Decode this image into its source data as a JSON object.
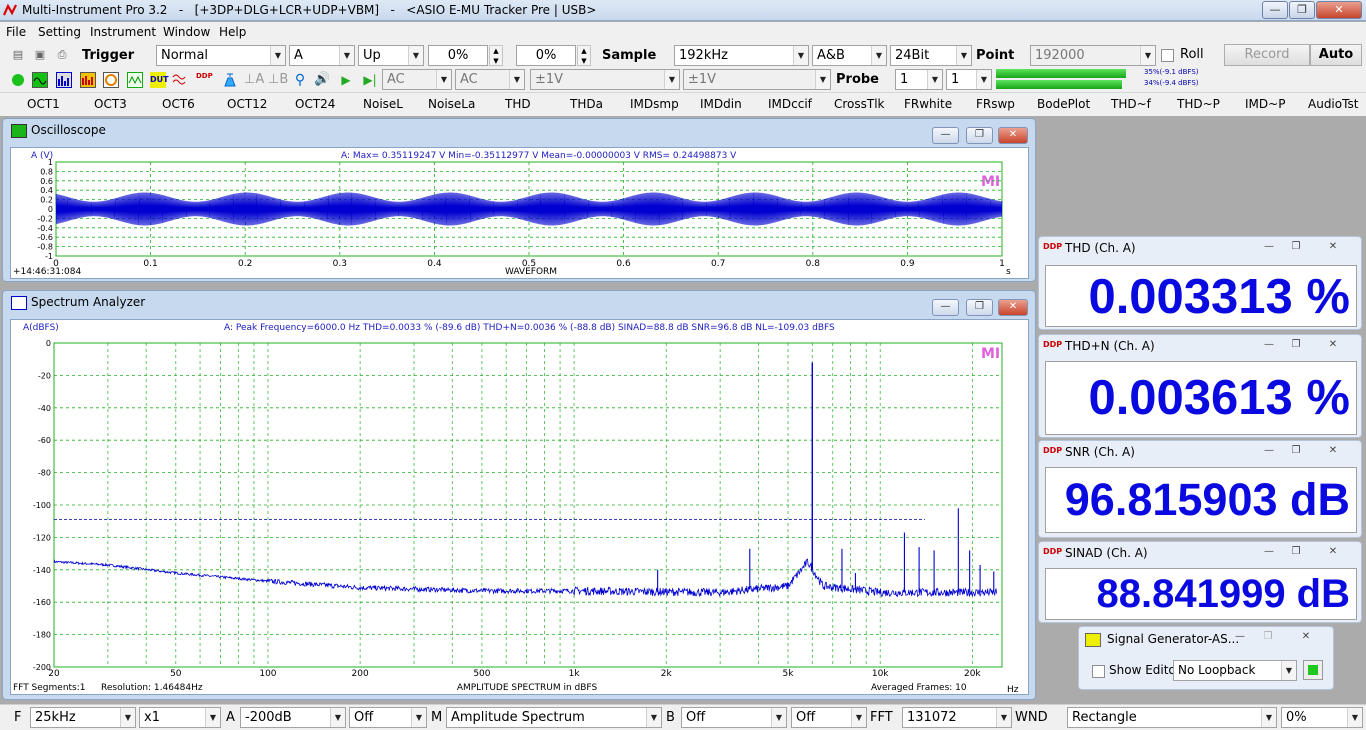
{
  "window": {
    "title": "Multi-Instrument Pro 3.2   -   [+3DP+DLG+LCR+UDP+VBM]   -   <ASIO E-MU Tracker Pre | USB>",
    "min_label": "—",
    "max_label": "❐",
    "close_label": "✕"
  },
  "menu": [
    "File",
    "Setting",
    "Instrument",
    "Window",
    "Help"
  ],
  "toolbar1": {
    "trigger_label": "Trigger",
    "trigger_mode": "Normal",
    "trigger_channel": "A",
    "trigger_edge": "Up",
    "trigger_level": "0%",
    "trigger_delay": "0%",
    "sample_label": "Sample",
    "sample_rate": "192kHz",
    "channels": "A&B",
    "bits": "24Bit",
    "point_label": "Point",
    "point_value": "192000",
    "roll_label": "Roll",
    "record_label": "Record",
    "auto_label": "Auto"
  },
  "toolbar2": {
    "coupling_a": "AC",
    "coupling_b": "AC",
    "range_a": "±1V",
    "range_b": "±1V",
    "probe_label": "Probe",
    "probe_a": "1",
    "probe_b": "1",
    "level_a_text": "35%(-9.1 dBFS)",
    "level_b_text": "34%(-9.4 dBFS)",
    "level_a_pct": 35,
    "level_b_pct": 34,
    "icons": [
      "run-icon",
      "scope-icon",
      "spectrum-icon",
      "spectrum3d-icon",
      "multimeter-icon",
      "dda-icon",
      "unit-icon",
      "thd-icon",
      "ddp-icon",
      "calibrate-icon",
      "lock-a-icon",
      "lock-b-icon",
      "probe-icon",
      "speaker-icon",
      "play-icon",
      "play-once-icon"
    ],
    "unit_text": "DUT",
    "ddp_text": "DDP"
  },
  "macros": [
    "OCT1",
    "OCT3",
    "OCT6",
    "OCT12",
    "OCT24",
    "NoiseL",
    "NoiseLa",
    "THD",
    "THDa",
    "IMDsmp",
    "IMDdin",
    "IMDccif",
    "CrossTlk",
    "FRwhite",
    "FRswp",
    "BodePlot",
    "THD~f",
    "THD~P",
    "IMD~P",
    "AudioTst"
  ],
  "oscilloscope": {
    "title": "Oscilloscope",
    "ylabel": "A (V)",
    "stats": "A: Max= 0.35119247 V  Min=-0.35112977 V  Mean=-0.00000003 V  RMS= 0.24498873 V",
    "timestamp": "+14:46:31:084",
    "xlabel": "WAVEFORM",
    "xunit": "s",
    "logo": "MI"
  },
  "spectrum": {
    "title": "Spectrum Analyzer",
    "ylabel": "A(dBFS)",
    "stats": "A: Peak Frequency=6000.0 Hz  THD=0.0033 % (-89.6 dB)  THD+N=0.0036 % (-88.8 dB)  SINAD=88.8 dB  SNR=96.8 dB  NL=-109.03 dBFS",
    "fft_segments": "FFT  Segments:1",
    "resolution": "Resolution: 1.46484Hz",
    "xlabel": "AMPLITUDE SPECTRUM in dBFS",
    "averaged": "Averaged Frames: 10",
    "xunit": "Hz",
    "logo": "MI"
  },
  "chart_data": [
    {
      "type": "line",
      "title": "",
      "ylabel": "A (V)",
      "xlabel": "WAVEFORM",
      "x_unit": "s",
      "xlim": [
        0,
        1
      ],
      "ylim": [
        -1,
        1
      ],
      "x_ticks": [
        0,
        0.1,
        0.2,
        0.3,
        0.4,
        0.5,
        0.6,
        0.7,
        0.8,
        0.9,
        1
      ],
      "y_ticks": [
        1,
        0.8,
        0.6,
        0.4,
        0.2,
        0,
        -0.2,
        -0.4,
        -0.6,
        -0.8,
        -1
      ],
      "series": [
        {
          "amplitude_max": 0.35119247,
          "amplitude_min": -0.35112977,
          "mean": -3e-08,
          "rms": 0.24498873
        }
      ],
      "grid": true
    },
    {
      "type": "line",
      "title": "",
      "ylabel": "A(dBFS)",
      "xlabel": "AMPLITUDE SPECTRUM in dBFS",
      "x_unit": "Hz",
      "x_scale": "log",
      "xlim": [
        20,
        25000
      ],
      "ylim": [
        -200,
        0
      ],
      "x_ticks": [
        20,
        50,
        100,
        200,
        500,
        1000,
        2000,
        5000,
        10000,
        20000
      ],
      "x_tick_labels": [
        "20",
        "50",
        "100",
        "200",
        "500",
        "1k",
        "2k",
        "5k",
        "10k",
        "20k"
      ],
      "y_ticks": [
        0,
        -20,
        -40,
        -60,
        -80,
        -100,
        -120,
        -140,
        -160,
        -180,
        -200
      ],
      "noise_floor_marker_dbfs": -109.03,
      "fundamental": {
        "x": 6000,
        "y": -12
      },
      "harmonic_spurs": [
        {
          "x": 1875,
          "y": -140
        },
        {
          "x": 3750,
          "y": -127
        },
        {
          "x": 7500,
          "y": -127
        },
        {
          "x": 8300,
          "y": -142
        },
        {
          "x": 12000,
          "y": -117
        },
        {
          "x": 13400,
          "y": -126
        },
        {
          "x": 15000,
          "y": -128
        },
        {
          "x": 18000,
          "y": -102
        },
        {
          "x": 19600,
          "y": -128
        },
        {
          "x": 21200,
          "y": -137
        },
        {
          "x": 23500,
          "y": -141
        }
      ],
      "noise_curve": [
        {
          "x": 20,
          "y": -135
        },
        {
          "x": 30,
          "y": -137
        },
        {
          "x": 50,
          "y": -142
        },
        {
          "x": 100,
          "y": -147
        },
        {
          "x": 200,
          "y": -151
        },
        {
          "x": 500,
          "y": -153
        },
        {
          "x": 1000,
          "y": -153
        },
        {
          "x": 3000,
          "y": -154
        },
        {
          "x": 5000,
          "y": -150
        },
        {
          "x": 5800,
          "y": -135
        },
        {
          "x": 6500,
          "y": -150
        },
        {
          "x": 10000,
          "y": -154
        },
        {
          "x": 25000,
          "y": -154
        }
      ],
      "grid": true
    }
  ],
  "meters": [
    {
      "title": "THD (Ch. A)",
      "value": "0.003313 %"
    },
    {
      "title": "THD+N (Ch. A)",
      "value": "0.003613 %"
    },
    {
      "title": "SNR (Ch. A)",
      "value": "96.815903 dB"
    },
    {
      "title": "SINAD (Ch. A)",
      "value": "88.841999 dB"
    }
  ],
  "siggen": {
    "title": "Signal Generator-AS...",
    "show_editor": "Show Editor",
    "loopback": "No Loopback"
  },
  "statusbar": {
    "f_label": "F",
    "f_value": "25kHz",
    "zoom": "x1",
    "a_label": "A",
    "a_value": "-200dB",
    "off1": "Off",
    "m_label": "M",
    "m_value": "Amplitude Spectrum",
    "b_label": "B",
    "b_value": "Off",
    "off2": "Off",
    "fft_label": "FFT",
    "fft_value": "131072",
    "wnd_label": "WND",
    "wnd_value": "Rectangle",
    "overlap": "0%"
  },
  "colors": {
    "accent": "#0a0ae0",
    "grid": "#22b022",
    "trace": "#0000d0",
    "title_blue": "#2020c0"
  }
}
